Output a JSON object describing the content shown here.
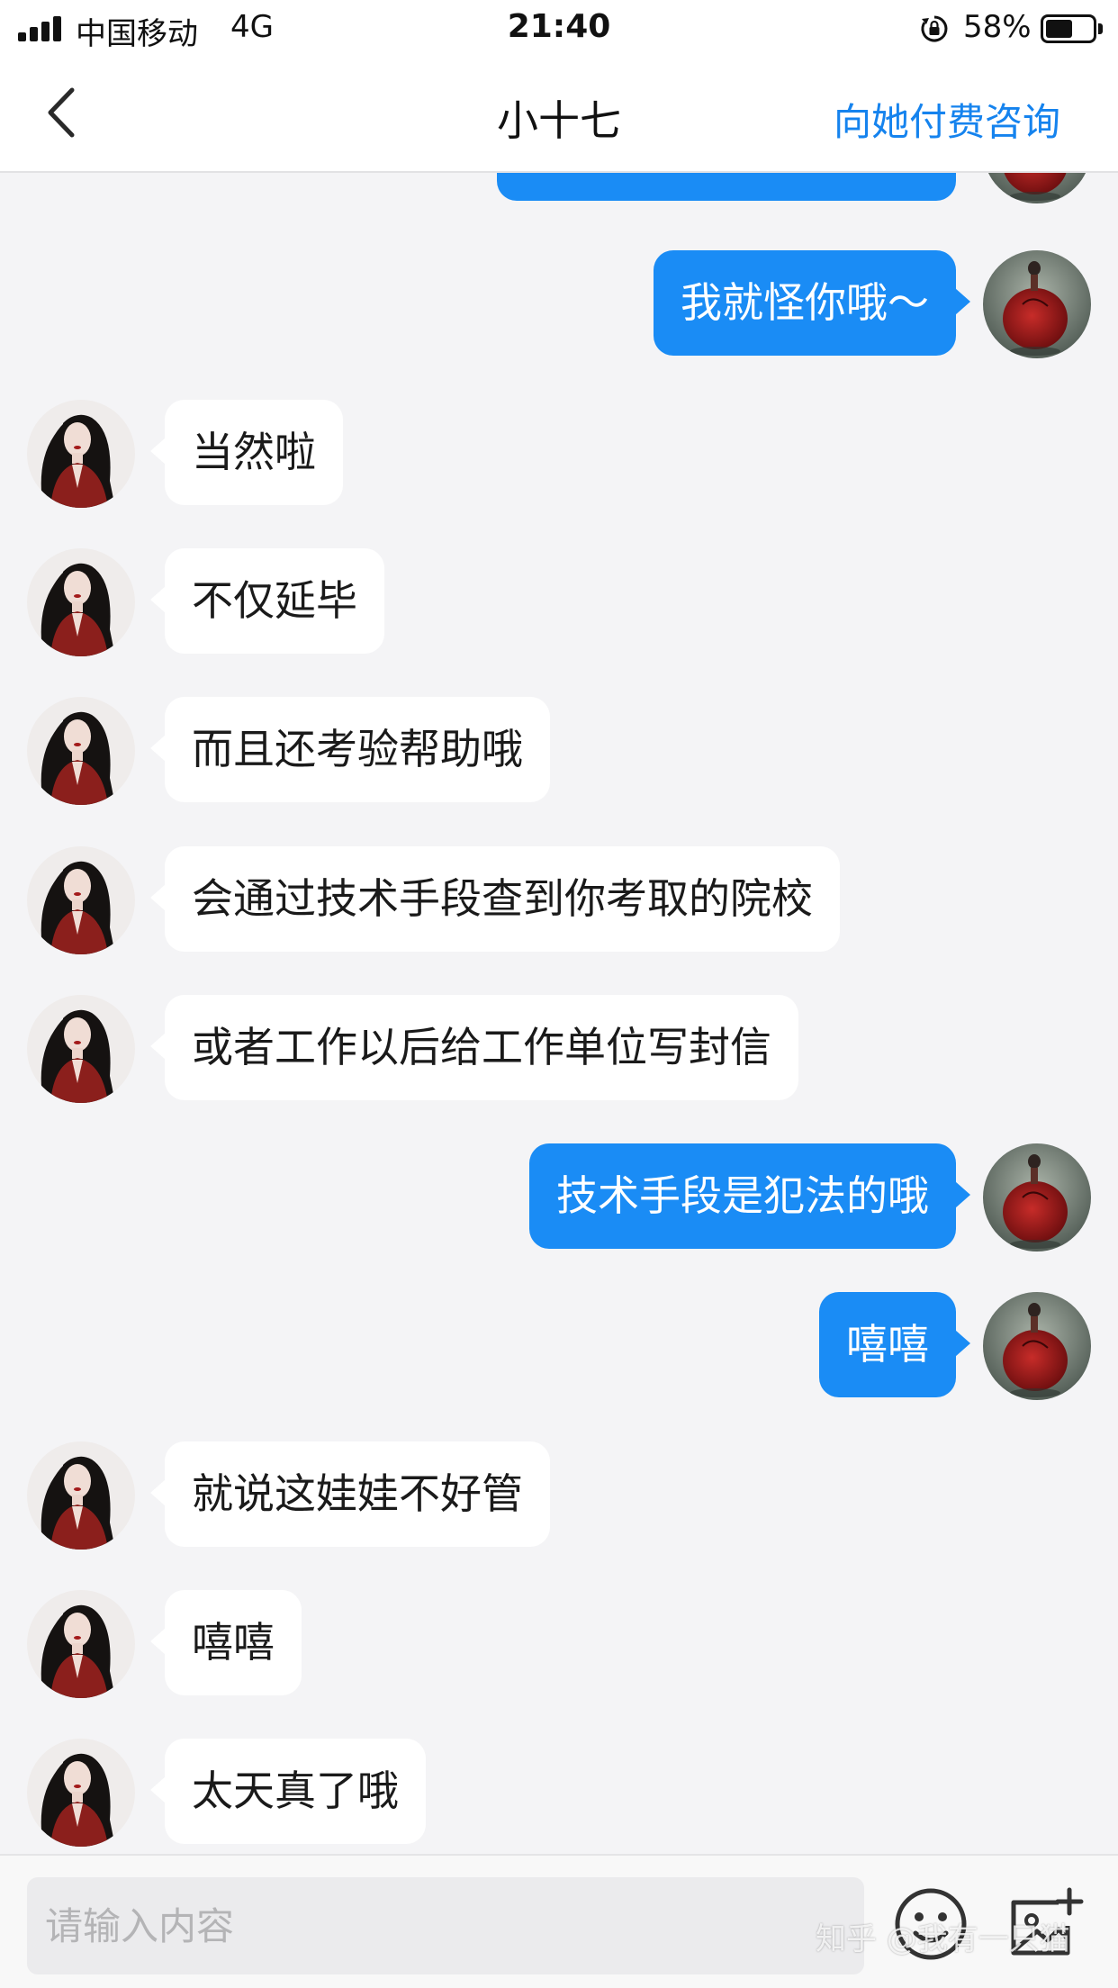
{
  "status_bar": {
    "carrier": "中国移动",
    "network": "4G",
    "time": "21:40",
    "battery_percent": "58%",
    "battery_level": 0.58
  },
  "nav": {
    "back_icon": "chevron-left-icon",
    "title": "小十七",
    "action_label": "向她付费咨询",
    "action_color": "#1583ee"
  },
  "colors": {
    "outgoing_bubble": "#1a8cf5",
    "incoming_bubble": "#ffffff",
    "background": "#f4f4f6"
  },
  "messages": [
    {
      "side": "out",
      "text": "我就怪你哦～"
    },
    {
      "side": "in",
      "text": "当然啦"
    },
    {
      "side": "in",
      "text": "不仅延毕"
    },
    {
      "side": "in",
      "text": "而且还考验帮助哦"
    },
    {
      "side": "in",
      "text": "会通过技术手段查到你考取的院校"
    },
    {
      "side": "in",
      "text": "或者工作以后给工作单位写封信"
    },
    {
      "side": "out",
      "text": "技术手段是犯法的哦"
    },
    {
      "side": "out",
      "text": "嘻嘻"
    },
    {
      "side": "in",
      "text": "就说这娃娃不好管"
    },
    {
      "side": "in",
      "text": "嘻嘻"
    },
    {
      "side": "in",
      "text": "太天真了哦"
    }
  ],
  "input": {
    "placeholder": "请输入内容",
    "value": "",
    "emoji_icon": "emoji-icon",
    "image_icon": "add-image-icon"
  },
  "watermark": "知乎 @我有一只猫"
}
